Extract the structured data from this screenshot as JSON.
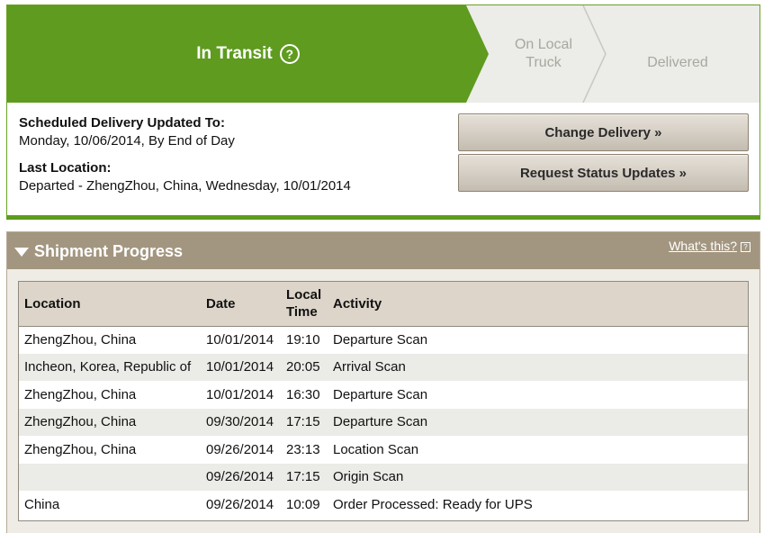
{
  "tracker": {
    "current_step": "In Transit",
    "help_glyph": "?",
    "step2_line1": "On Local",
    "step2_line2": "Truck",
    "step3": "Delivered",
    "colors": {
      "active": "#5e9b1f",
      "inactive": "#ecece8"
    }
  },
  "delivery": {
    "scheduled_label": "Scheduled Delivery Updated To:",
    "scheduled_value": "Monday, 10/06/2014, By End of Day",
    "last_location_label": "Last Location:",
    "last_location_value": "Departed - ZhengZhou, China, Wednesday, 10/01/2014"
  },
  "buttons": {
    "change_delivery": "Change Delivery »",
    "request_updates": "Request Status Updates »"
  },
  "shipment_progress": {
    "title": "Shipment Progress",
    "whats_this": "What's this?",
    "columns": {
      "location": "Location",
      "date": "Date",
      "local_time_line1": "Local",
      "local_time_line2": "Time",
      "activity": "Activity"
    },
    "rows": [
      {
        "location": "ZhengZhou, China",
        "date": "10/01/2014",
        "time": "19:10",
        "activity": "Departure Scan"
      },
      {
        "location": "Incheon, Korea, Republic of",
        "date": "10/01/2014",
        "time": "20:05",
        "activity": "Arrival Scan"
      },
      {
        "location": "ZhengZhou, China",
        "date": "10/01/2014",
        "time": "16:30",
        "activity": "Departure Scan"
      },
      {
        "location": "ZhengZhou, China",
        "date": "09/30/2014",
        "time": "17:15",
        "activity": "Departure Scan"
      },
      {
        "location": "ZhengZhou, China",
        "date": "09/26/2014",
        "time": "23:13",
        "activity": "Location Scan"
      },
      {
        "location": "",
        "date": "09/26/2014",
        "time": "17:15",
        "activity": "Origin Scan"
      },
      {
        "location": "China",
        "date": "09/26/2014",
        "time": "10:09",
        "activity": "Order Processed: Ready for UPS"
      }
    ]
  }
}
